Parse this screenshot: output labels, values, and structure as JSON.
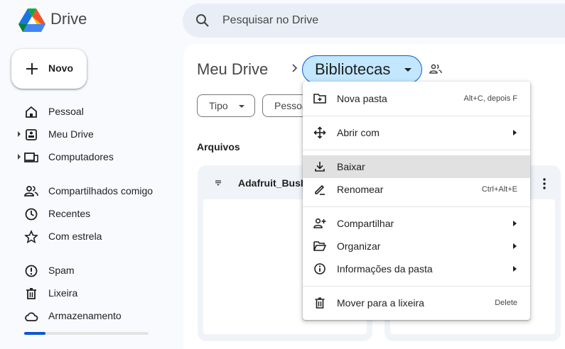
{
  "header": {
    "brand": "Drive",
    "search_placeholder": "Pesquisar no Drive"
  },
  "new_button": {
    "label": "Novo"
  },
  "sidebar": {
    "items": [
      {
        "label": "Pessoal",
        "icon": "home-icon"
      },
      {
        "label": "Meu Drive",
        "icon": "my-drive-icon"
      },
      {
        "label": "Computadores",
        "icon": "computers-icon"
      },
      {
        "label": "Compartilhados comigo",
        "icon": "people-icon"
      },
      {
        "label": "Recentes",
        "icon": "clock-icon"
      },
      {
        "label": "Com estrela",
        "icon": "star-icon"
      },
      {
        "label": "Spam",
        "icon": "spam-icon"
      },
      {
        "label": "Lixeira",
        "icon": "trash-icon"
      },
      {
        "label": "Armazenamento",
        "icon": "cloud-icon"
      }
    ],
    "storage_used_fraction": 0.17
  },
  "breadcrumb": {
    "root": "Meu Drive",
    "current": "Bibliotecas"
  },
  "filters": {
    "type": "Tipo",
    "people": "Pessoas"
  },
  "section_title": "Arquivos",
  "files": [
    {
      "name": "Adafruit_BusIO",
      "icon": "folder-icon"
    }
  ],
  "context_menu": {
    "new_folder": {
      "label": "Nova pasta",
      "shortcut": "Alt+C, depois F"
    },
    "open_with": {
      "label": "Abrir com"
    },
    "download": {
      "label": "Baixar"
    },
    "rename": {
      "label": "Renomear",
      "shortcut": "Ctrl+Alt+E"
    },
    "share": {
      "label": "Compartilhar"
    },
    "organize": {
      "label": "Organizar"
    },
    "folder_info": {
      "label": "Informações da pasta"
    },
    "move_to_trash": {
      "label": "Mover para a lixeira",
      "shortcut": "Delete"
    }
  },
  "colors": {
    "accent": "#0b57d0",
    "selected_chip": "#c2e7ff",
    "highlight": "#e1e1e1"
  }
}
